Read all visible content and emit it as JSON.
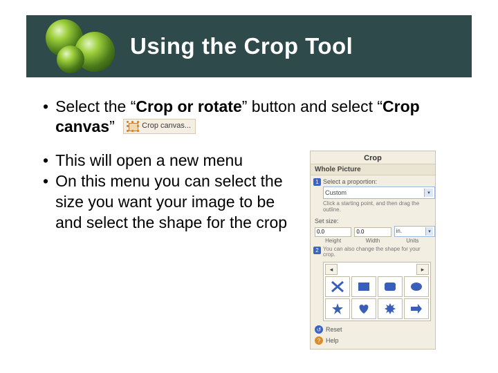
{
  "header": {
    "title": "Using the Crop Tool"
  },
  "bullets": {
    "b1_prefix": "Select the “",
    "b1_bold": "Crop or rotate",
    "b1_mid": "” button and select “",
    "b1_bold2": "Crop canvas",
    "b1_suffix": "”",
    "b2": "This will open a new menu",
    "b3": "On this menu you can select the size you want your image to be and select the shape for the crop"
  },
  "inline_button": {
    "label": "Crop canvas..."
  },
  "panel": {
    "title": "Crop",
    "subtitle": "Whole Picture",
    "step1_label": "Select a proportion:",
    "proportion_value": "Custom",
    "step1_num": "1",
    "hint": "Click a starting point, and then drag the outline.",
    "size_title": "Set size:",
    "height_val": "0.0",
    "width_val": "0.0",
    "height_lbl": "Height",
    "width_lbl": "Width",
    "units_lbl": "Units",
    "step2_num": "2",
    "step2_text": "You can also change the shape for your crop.",
    "reset": "Reset",
    "help": "Help"
  }
}
